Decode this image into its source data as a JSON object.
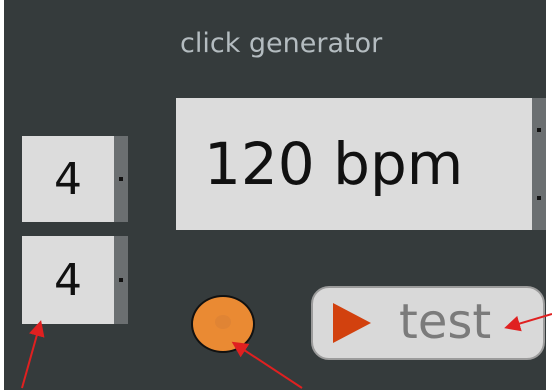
{
  "panel": {
    "title": "click generator"
  },
  "time_signature": {
    "numerator": "4",
    "denominator": "4"
  },
  "tempo": {
    "value": "120 bpm"
  },
  "test_button": {
    "label": "test"
  },
  "colors": {
    "panel_bg": "#353b3c",
    "led": "#ea8a33",
    "play_icon": "#d2410e",
    "annotation_arrow": "#e02020"
  }
}
